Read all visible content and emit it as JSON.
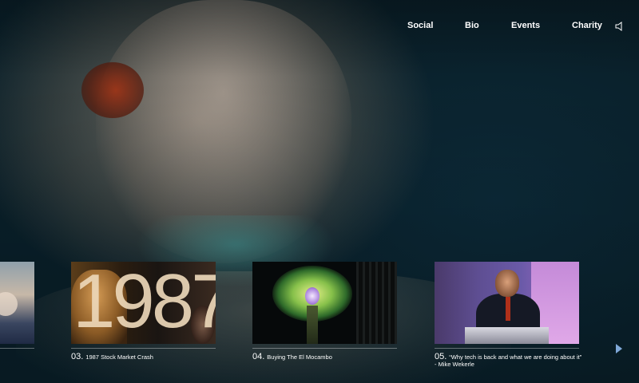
{
  "nav": {
    "items": [
      "Social",
      "Bio",
      "Events",
      "Charity"
    ],
    "sound_icon": "speaker-icon"
  },
  "hero": {
    "image": "background-portrait"
  },
  "timeline": {
    "cards": [
      {
        "num": "",
        "title": ""
      },
      {
        "num": "03.",
        "title": "1987 Stock Market Crash",
        "thumb_text": "1987"
      },
      {
        "num": "04.",
        "title": "Buying The El Mocambo"
      },
      {
        "num": "05.",
        "title": "“Why tech is back and what we are doing about it” - Mike Wekerle"
      }
    ],
    "next_icon": "chevron-right-icon"
  },
  "colors": {
    "accent_arrow": "#7fa8d8",
    "text": "#ffffff"
  }
}
